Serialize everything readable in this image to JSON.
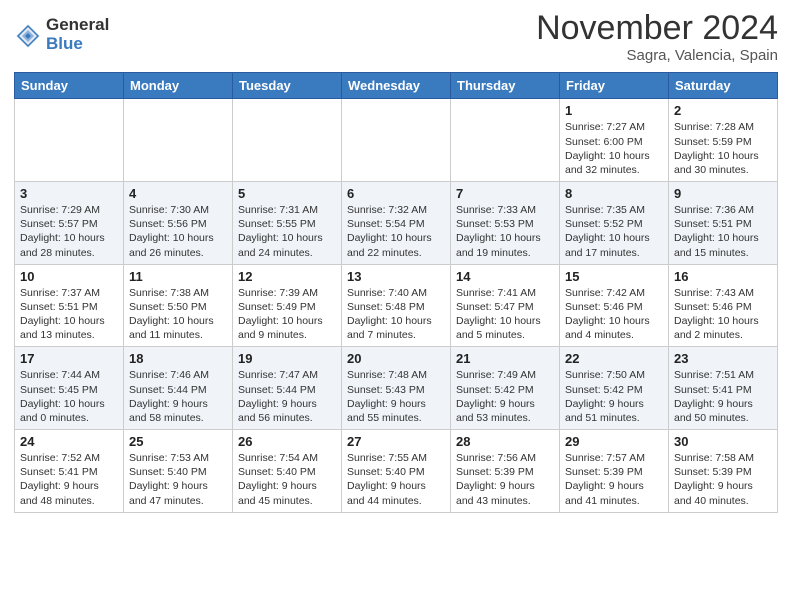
{
  "header": {
    "logo_general": "General",
    "logo_blue": "Blue",
    "month_title": "November 2024",
    "location": "Sagra, Valencia, Spain"
  },
  "days_of_week": [
    "Sunday",
    "Monday",
    "Tuesday",
    "Wednesday",
    "Thursday",
    "Friday",
    "Saturday"
  ],
  "weeks": [
    [
      {
        "day": "",
        "info": ""
      },
      {
        "day": "",
        "info": ""
      },
      {
        "day": "",
        "info": ""
      },
      {
        "day": "",
        "info": ""
      },
      {
        "day": "",
        "info": ""
      },
      {
        "day": "1",
        "info": "Sunrise: 7:27 AM\nSunset: 6:00 PM\nDaylight: 10 hours\nand 32 minutes."
      },
      {
        "day": "2",
        "info": "Sunrise: 7:28 AM\nSunset: 5:59 PM\nDaylight: 10 hours\nand 30 minutes."
      }
    ],
    [
      {
        "day": "3",
        "info": "Sunrise: 7:29 AM\nSunset: 5:57 PM\nDaylight: 10 hours\nand 28 minutes."
      },
      {
        "day": "4",
        "info": "Sunrise: 7:30 AM\nSunset: 5:56 PM\nDaylight: 10 hours\nand 26 minutes."
      },
      {
        "day": "5",
        "info": "Sunrise: 7:31 AM\nSunset: 5:55 PM\nDaylight: 10 hours\nand 24 minutes."
      },
      {
        "day": "6",
        "info": "Sunrise: 7:32 AM\nSunset: 5:54 PM\nDaylight: 10 hours\nand 22 minutes."
      },
      {
        "day": "7",
        "info": "Sunrise: 7:33 AM\nSunset: 5:53 PM\nDaylight: 10 hours\nand 19 minutes."
      },
      {
        "day": "8",
        "info": "Sunrise: 7:35 AM\nSunset: 5:52 PM\nDaylight: 10 hours\nand 17 minutes."
      },
      {
        "day": "9",
        "info": "Sunrise: 7:36 AM\nSunset: 5:51 PM\nDaylight: 10 hours\nand 15 minutes."
      }
    ],
    [
      {
        "day": "10",
        "info": "Sunrise: 7:37 AM\nSunset: 5:51 PM\nDaylight: 10 hours\nand 13 minutes."
      },
      {
        "day": "11",
        "info": "Sunrise: 7:38 AM\nSunset: 5:50 PM\nDaylight: 10 hours\nand 11 minutes."
      },
      {
        "day": "12",
        "info": "Sunrise: 7:39 AM\nSunset: 5:49 PM\nDaylight: 10 hours\nand 9 minutes."
      },
      {
        "day": "13",
        "info": "Sunrise: 7:40 AM\nSunset: 5:48 PM\nDaylight: 10 hours\nand 7 minutes."
      },
      {
        "day": "14",
        "info": "Sunrise: 7:41 AM\nSunset: 5:47 PM\nDaylight: 10 hours\nand 5 minutes."
      },
      {
        "day": "15",
        "info": "Sunrise: 7:42 AM\nSunset: 5:46 PM\nDaylight: 10 hours\nand 4 minutes."
      },
      {
        "day": "16",
        "info": "Sunrise: 7:43 AM\nSunset: 5:46 PM\nDaylight: 10 hours\nand 2 minutes."
      }
    ],
    [
      {
        "day": "17",
        "info": "Sunrise: 7:44 AM\nSunset: 5:45 PM\nDaylight: 10 hours\nand 0 minutes."
      },
      {
        "day": "18",
        "info": "Sunrise: 7:46 AM\nSunset: 5:44 PM\nDaylight: 9 hours\nand 58 minutes."
      },
      {
        "day": "19",
        "info": "Sunrise: 7:47 AM\nSunset: 5:44 PM\nDaylight: 9 hours\nand 56 minutes."
      },
      {
        "day": "20",
        "info": "Sunrise: 7:48 AM\nSunset: 5:43 PM\nDaylight: 9 hours\nand 55 minutes."
      },
      {
        "day": "21",
        "info": "Sunrise: 7:49 AM\nSunset: 5:42 PM\nDaylight: 9 hours\nand 53 minutes."
      },
      {
        "day": "22",
        "info": "Sunrise: 7:50 AM\nSunset: 5:42 PM\nDaylight: 9 hours\nand 51 minutes."
      },
      {
        "day": "23",
        "info": "Sunrise: 7:51 AM\nSunset: 5:41 PM\nDaylight: 9 hours\nand 50 minutes."
      }
    ],
    [
      {
        "day": "24",
        "info": "Sunrise: 7:52 AM\nSunset: 5:41 PM\nDaylight: 9 hours\nand 48 minutes."
      },
      {
        "day": "25",
        "info": "Sunrise: 7:53 AM\nSunset: 5:40 PM\nDaylight: 9 hours\nand 47 minutes."
      },
      {
        "day": "26",
        "info": "Sunrise: 7:54 AM\nSunset: 5:40 PM\nDaylight: 9 hours\nand 45 minutes."
      },
      {
        "day": "27",
        "info": "Sunrise: 7:55 AM\nSunset: 5:40 PM\nDaylight: 9 hours\nand 44 minutes."
      },
      {
        "day": "28",
        "info": "Sunrise: 7:56 AM\nSunset: 5:39 PM\nDaylight: 9 hours\nand 43 minutes."
      },
      {
        "day": "29",
        "info": "Sunrise: 7:57 AM\nSunset: 5:39 PM\nDaylight: 9 hours\nand 41 minutes."
      },
      {
        "day": "30",
        "info": "Sunrise: 7:58 AM\nSunset: 5:39 PM\nDaylight: 9 hours\nand 40 minutes."
      }
    ]
  ]
}
